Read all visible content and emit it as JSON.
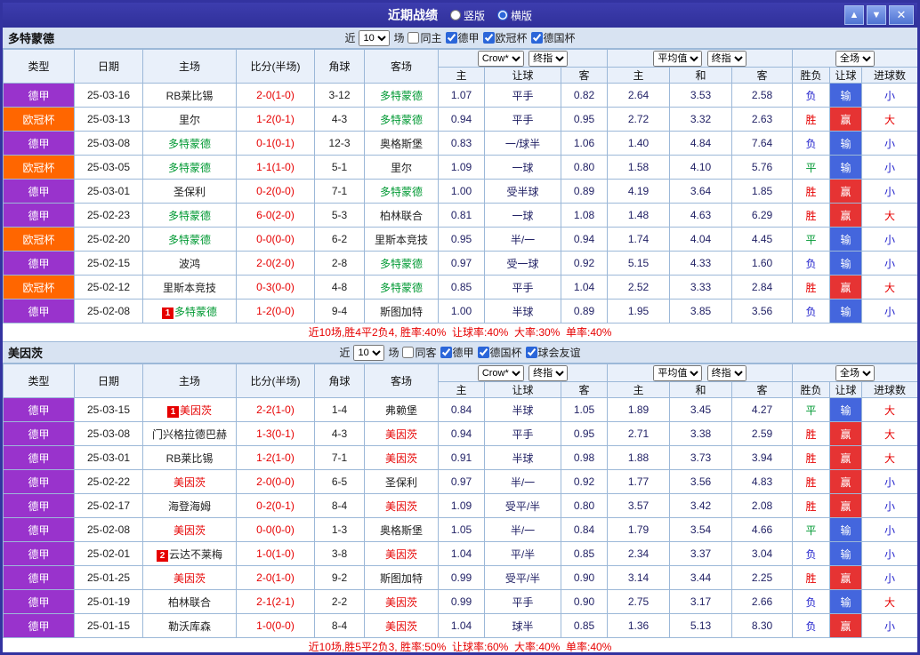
{
  "titlebar": {
    "title": "近期战绩",
    "layout_options": [
      {
        "label": "竖版",
        "selected": false
      },
      {
        "label": "横版",
        "selected": true
      }
    ],
    "buttons": {
      "up": "▲",
      "down": "▼",
      "close": "✕"
    }
  },
  "table_header": {
    "cols": [
      "类型",
      "日期",
      "主场",
      "比分(半场)",
      "角球",
      "客场"
    ],
    "odds_group": {
      "bookmaker": "Crow*",
      "index": "终指",
      "sub": [
        "主",
        "让球",
        "客"
      ]
    },
    "avg_group": {
      "label": "平均值",
      "index": "终指",
      "sub": [
        "主",
        "和",
        "客"
      ]
    },
    "scope_group": {
      "label": "全场",
      "sub": [
        "胜负",
        "让球",
        "进球数"
      ]
    }
  },
  "league_colors": {
    "德甲": "#9933cc",
    "欧冠杯": "#ff6600"
  },
  "result_colors": {
    "胜": "#e60000",
    "平": "#009933",
    "负": "#2222cc"
  },
  "handicap_colors": {
    "输": "#4466dd",
    "赢": "#e63333"
  },
  "goals_colors": {
    "大": "#e60000",
    "小": "#2222cc"
  },
  "sections": [
    {
      "team": "多特蒙德",
      "focus_color": "#009933",
      "filter": {
        "near": "近",
        "count": "10",
        "unit": "场",
        "venue": {
          "label": "同主",
          "checked": false
        },
        "leagues": [
          {
            "label": "德甲",
            "checked": true
          },
          {
            "label": "欧冠杯",
            "checked": true
          },
          {
            "label": "德国杯",
            "checked": true
          }
        ]
      },
      "summary": "近10场,胜4平2负4, 胜率:40%  让球率:40%  大率:30%  单率:40%",
      "rows": [
        {
          "league": "德甲",
          "date": "25-03-16",
          "home": {
            "name": "RB莱比锡"
          },
          "score": "2-0(1-0)",
          "corner": "3-12",
          "away": {
            "name": "多特蒙德",
            "focus": true
          },
          "odds": [
            "1.07",
            "平手",
            "0.82"
          ],
          "avg": [
            "2.64",
            "3.53",
            "2.58"
          ],
          "result": "负",
          "handicap": "输",
          "goals": "小"
        },
        {
          "league": "欧冠杯",
          "date": "25-03-13",
          "home": {
            "name": "里尔"
          },
          "score": "1-2(0-1)",
          "corner": "4-3",
          "away": {
            "name": "多特蒙德",
            "focus": true
          },
          "odds": [
            "0.94",
            "平手",
            "0.95"
          ],
          "avg": [
            "2.72",
            "3.32",
            "2.63"
          ],
          "result": "胜",
          "handicap": "赢",
          "goals": "大"
        },
        {
          "league": "德甲",
          "date": "25-03-08",
          "home": {
            "name": "多特蒙德",
            "focus": true
          },
          "score": "0-1(0-1)",
          "corner": "12-3",
          "away": {
            "name": "奥格斯堡"
          },
          "odds": [
            "0.83",
            "一/球半",
            "1.06"
          ],
          "avg": [
            "1.40",
            "4.84",
            "7.64"
          ],
          "result": "负",
          "handicap": "输",
          "goals": "小"
        },
        {
          "league": "欧冠杯",
          "date": "25-03-05",
          "home": {
            "name": "多特蒙德",
            "focus": true
          },
          "score": "1-1(1-0)",
          "corner": "5-1",
          "away": {
            "name": "里尔"
          },
          "odds": [
            "1.09",
            "一球",
            "0.80"
          ],
          "avg": [
            "1.58",
            "4.10",
            "5.76"
          ],
          "result": "平",
          "handicap": "输",
          "goals": "小"
        },
        {
          "league": "德甲",
          "date": "25-03-01",
          "home": {
            "name": "圣保利"
          },
          "score": "0-2(0-0)",
          "corner": "7-1",
          "away": {
            "name": "多特蒙德",
            "focus": true
          },
          "odds": [
            "1.00",
            "受半球",
            "0.89"
          ],
          "avg": [
            "4.19",
            "3.64",
            "1.85"
          ],
          "result": "胜",
          "handicap": "赢",
          "goals": "小"
        },
        {
          "league": "德甲",
          "date": "25-02-23",
          "home": {
            "name": "多特蒙德",
            "focus": true
          },
          "score": "6-0(2-0)",
          "corner": "5-3",
          "away": {
            "name": "柏林联合"
          },
          "odds": [
            "0.81",
            "一球",
            "1.08"
          ],
          "avg": [
            "1.48",
            "4.63",
            "6.29"
          ],
          "result": "胜",
          "handicap": "赢",
          "goals": "大"
        },
        {
          "league": "欧冠杯",
          "date": "25-02-20",
          "home": {
            "name": "多特蒙德",
            "focus": true
          },
          "score": "0-0(0-0)",
          "corner": "6-2",
          "away": {
            "name": "里斯本竞技"
          },
          "odds": [
            "0.95",
            "半/一",
            "0.94"
          ],
          "avg": [
            "1.74",
            "4.04",
            "4.45"
          ],
          "result": "平",
          "handicap": "输",
          "goals": "小"
        },
        {
          "league": "德甲",
          "date": "25-02-15",
          "home": {
            "name": "波鸿"
          },
          "score": "2-0(2-0)",
          "corner": "2-8",
          "away": {
            "name": "多特蒙德",
            "focus": true
          },
          "odds": [
            "0.97",
            "受一球",
            "0.92"
          ],
          "avg": [
            "5.15",
            "4.33",
            "1.60"
          ],
          "result": "负",
          "handicap": "输",
          "goals": "小"
        },
        {
          "league": "欧冠杯",
          "date": "25-02-12",
          "home": {
            "name": "里斯本竞技"
          },
          "score": "0-3(0-0)",
          "corner": "4-8",
          "away": {
            "name": "多特蒙德",
            "focus": true
          },
          "odds": [
            "0.85",
            "平手",
            "1.04"
          ],
          "avg": [
            "2.52",
            "3.33",
            "2.84"
          ],
          "result": "胜",
          "handicap": "赢",
          "goals": "大"
        },
        {
          "league": "德甲",
          "date": "25-02-08",
          "home": {
            "name": "多特蒙德",
            "focus": true,
            "badge": "1"
          },
          "score": "1-2(0-0)",
          "corner": "9-4",
          "away": {
            "name": "斯图加特"
          },
          "odds": [
            "1.00",
            "半球",
            "0.89"
          ],
          "avg": [
            "1.95",
            "3.85",
            "3.56"
          ],
          "result": "负",
          "handicap": "输",
          "goals": "小"
        }
      ]
    },
    {
      "team": "美因茨",
      "focus_color": "#e60000",
      "filter": {
        "near": "近",
        "count": "10",
        "unit": "场",
        "venue": {
          "label": "同客",
          "checked": false
        },
        "leagues": [
          {
            "label": "德甲",
            "checked": true
          },
          {
            "label": "德国杯",
            "checked": true
          },
          {
            "label": "球会友谊",
            "checked": true
          }
        ]
      },
      "summary": "近10场,胜5平2负3, 胜率:50%  让球率:60%  大率:40%  单率:40%",
      "rows": [
        {
          "league": "德甲",
          "date": "25-03-15",
          "home": {
            "name": "美因茨",
            "focus": true,
            "badge": "1"
          },
          "score": "2-2(1-0)",
          "corner": "1-4",
          "away": {
            "name": "弗赖堡"
          },
          "odds": [
            "0.84",
            "半球",
            "1.05"
          ],
          "avg": [
            "1.89",
            "3.45",
            "4.27"
          ],
          "result": "平",
          "handicap": "输",
          "goals": "大"
        },
        {
          "league": "德甲",
          "date": "25-03-08",
          "home": {
            "name": "门兴格拉德巴赫"
          },
          "score": "1-3(0-1)",
          "corner": "4-3",
          "away": {
            "name": "美因茨",
            "focus": true
          },
          "odds": [
            "0.94",
            "平手",
            "0.95"
          ],
          "avg": [
            "2.71",
            "3.38",
            "2.59"
          ],
          "result": "胜",
          "handicap": "赢",
          "goals": "大"
        },
        {
          "league": "德甲",
          "date": "25-03-01",
          "home": {
            "name": "RB莱比锡"
          },
          "score": "1-2(1-0)",
          "corner": "7-1",
          "away": {
            "name": "美因茨",
            "focus": true
          },
          "odds": [
            "0.91",
            "半球",
            "0.98"
          ],
          "avg": [
            "1.88",
            "3.73",
            "3.94"
          ],
          "result": "胜",
          "handicap": "赢",
          "goals": "大"
        },
        {
          "league": "德甲",
          "date": "25-02-22",
          "home": {
            "name": "美因茨",
            "focus": true
          },
          "score": "2-0(0-0)",
          "corner": "6-5",
          "away": {
            "name": "圣保利"
          },
          "odds": [
            "0.97",
            "半/一",
            "0.92"
          ],
          "avg": [
            "1.77",
            "3.56",
            "4.83"
          ],
          "result": "胜",
          "handicap": "赢",
          "goals": "小"
        },
        {
          "league": "德甲",
          "date": "25-02-17",
          "home": {
            "name": "海登海姆"
          },
          "score": "0-2(0-1)",
          "corner": "8-4",
          "away": {
            "name": "美因茨",
            "focus": true
          },
          "odds": [
            "1.09",
            "受平/半",
            "0.80"
          ],
          "avg": [
            "3.57",
            "3.42",
            "2.08"
          ],
          "result": "胜",
          "handicap": "赢",
          "goals": "小"
        },
        {
          "league": "德甲",
          "date": "25-02-08",
          "home": {
            "name": "美因茨",
            "focus": true
          },
          "score": "0-0(0-0)",
          "corner": "1-3",
          "away": {
            "name": "奥格斯堡"
          },
          "odds": [
            "1.05",
            "半/一",
            "0.84"
          ],
          "avg": [
            "1.79",
            "3.54",
            "4.66"
          ],
          "result": "平",
          "handicap": "输",
          "goals": "小"
        },
        {
          "league": "德甲",
          "date": "25-02-01",
          "home": {
            "name": "云达不莱梅",
            "badge": "2"
          },
          "score": "1-0(1-0)",
          "corner": "3-8",
          "away": {
            "name": "美因茨",
            "focus": true
          },
          "odds": [
            "1.04",
            "平/半",
            "0.85"
          ],
          "avg": [
            "2.34",
            "3.37",
            "3.04"
          ],
          "result": "负",
          "handicap": "输",
          "goals": "小"
        },
        {
          "league": "德甲",
          "date": "25-01-25",
          "home": {
            "name": "美因茨",
            "focus": true
          },
          "score": "2-0(1-0)",
          "corner": "9-2",
          "away": {
            "name": "斯图加特"
          },
          "odds": [
            "0.99",
            "受平/半",
            "0.90"
          ],
          "avg": [
            "3.14",
            "3.44",
            "2.25"
          ],
          "result": "胜",
          "handicap": "赢",
          "goals": "小"
        },
        {
          "league": "德甲",
          "date": "25-01-19",
          "home": {
            "name": "柏林联合"
          },
          "score": "2-1(2-1)",
          "corner": "2-2",
          "away": {
            "name": "美因茨",
            "focus": true
          },
          "odds": [
            "0.99",
            "平手",
            "0.90"
          ],
          "avg": [
            "2.75",
            "3.17",
            "2.66"
          ],
          "result": "负",
          "handicap": "输",
          "goals": "大"
        },
        {
          "league": "德甲",
          "date": "25-01-15",
          "home": {
            "name": "勒沃库森"
          },
          "score": "1-0(0-0)",
          "corner": "8-4",
          "away": {
            "name": "美因茨",
            "focus": true
          },
          "odds": [
            "1.04",
            "球半",
            "0.85"
          ],
          "avg": [
            "1.36",
            "5.13",
            "8.30"
          ],
          "result": "负",
          "handicap": "赢",
          "goals": "小"
        }
      ]
    }
  ]
}
